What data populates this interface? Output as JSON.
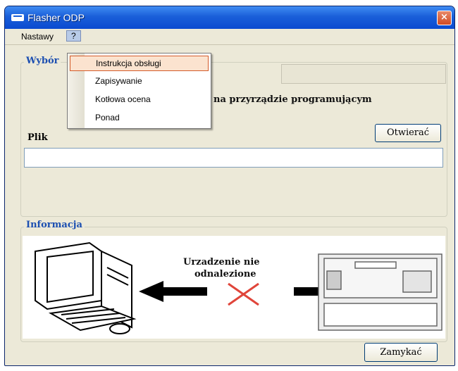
{
  "window": {
    "title": "Flasher ODP",
    "close_label": "×"
  },
  "menubar": {
    "items": [
      "Nastawy",
      "?"
    ]
  },
  "help_menu": {
    "items": [
      "Instrukcja obsługi",
      "Zapisywanie",
      "Kotłowa ocena",
      "Ponad"
    ],
    "selected_index": 0
  },
  "selection_group": {
    "title": "Wybór",
    "status_text": "na przyrządzie programującym",
    "file_label": "Plik",
    "open_button": "Otwierać",
    "file_value": ""
  },
  "info_group": {
    "title": "Informacja",
    "status_line1": "Urzadzenie nie",
    "status_line2": "odnalezione"
  },
  "footer": {
    "close_button": "Zamykać"
  },
  "colors": {
    "accent": "#1c4fb1",
    "error_x": "#e0453a",
    "menu_highlight": "#fbe3cf"
  }
}
